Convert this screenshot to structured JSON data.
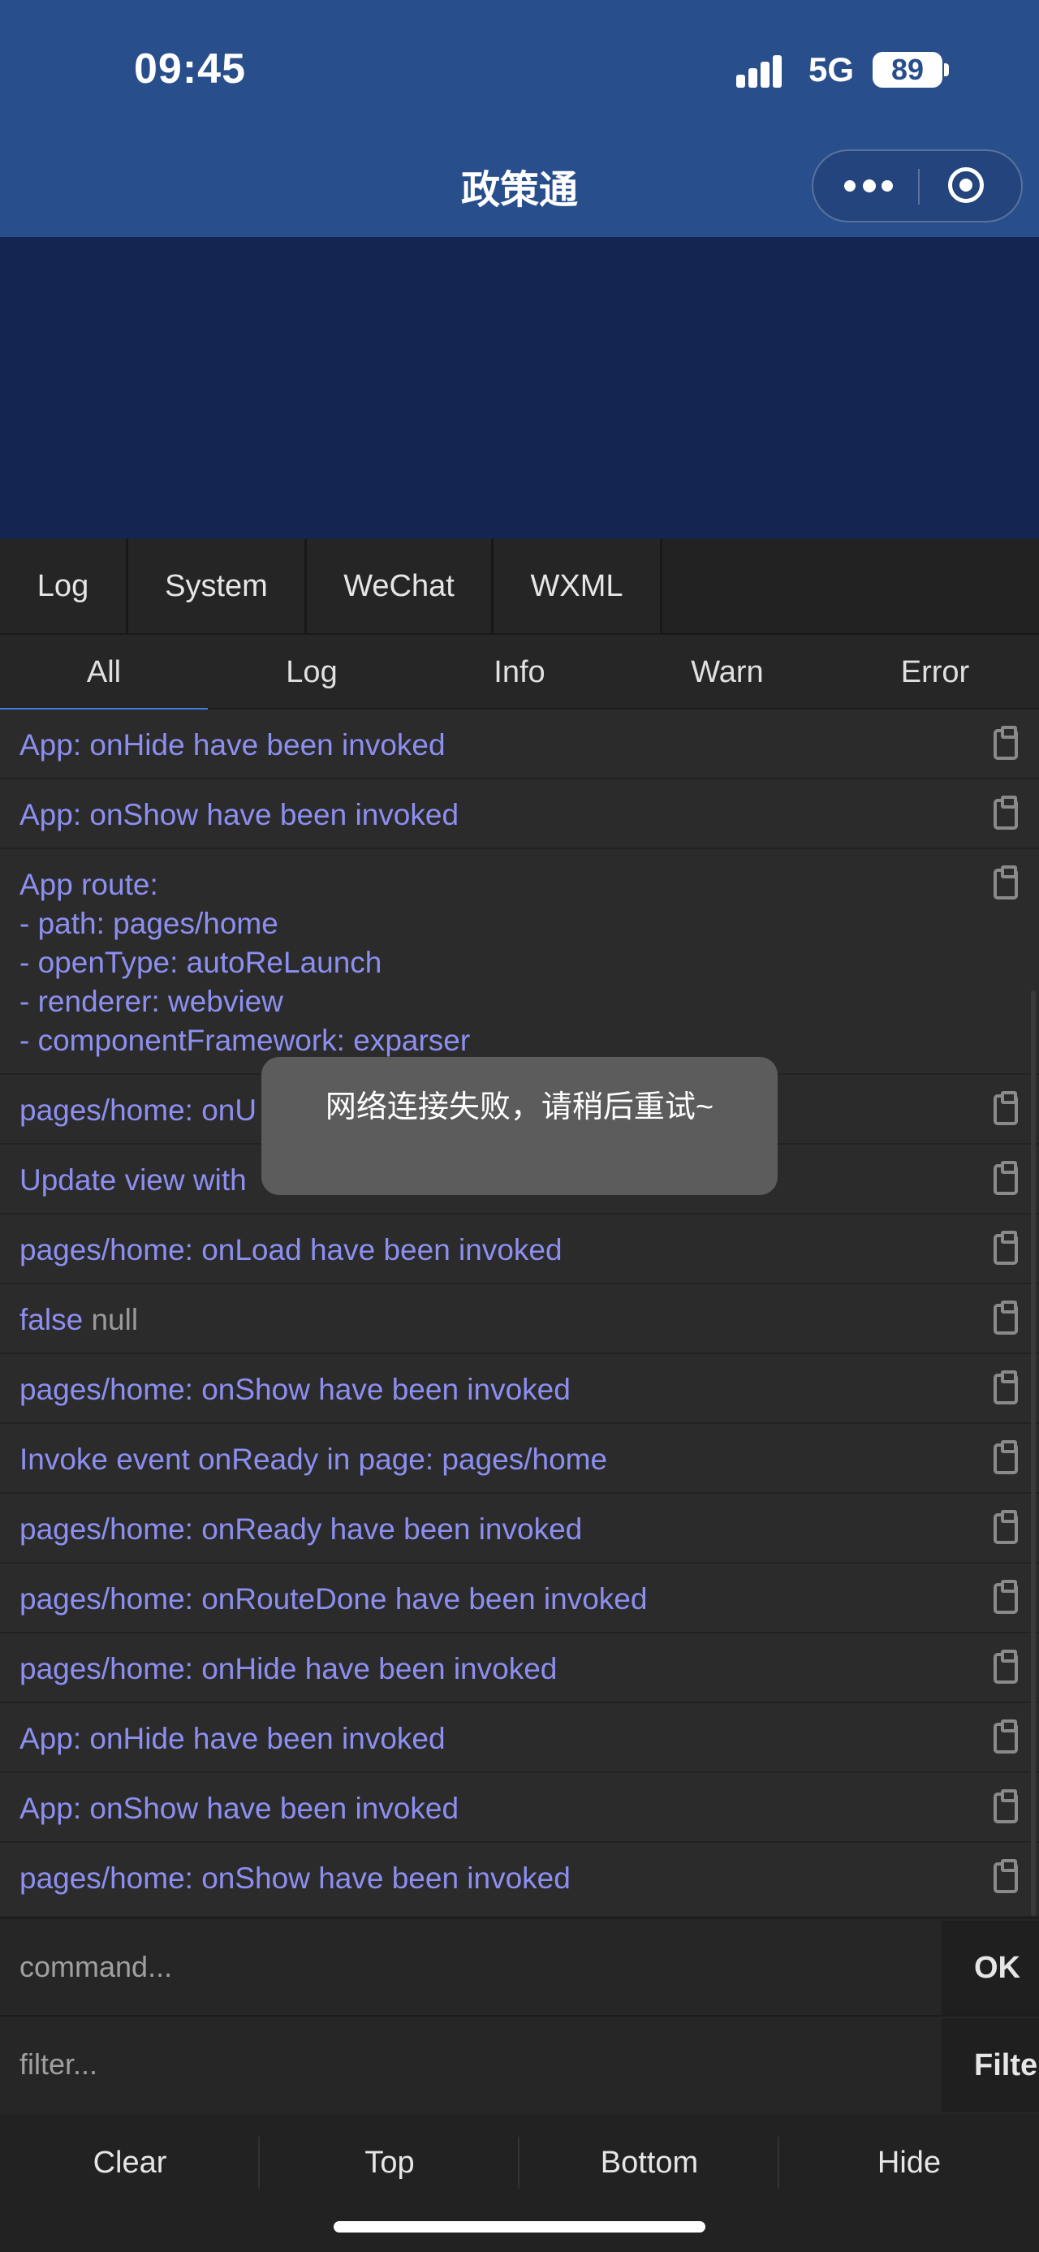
{
  "status_bar": {
    "time": "09:45",
    "network": "5G",
    "battery": "89"
  },
  "header": {
    "title": "政策通"
  },
  "tabs": [
    {
      "label": "Log"
    },
    {
      "label": "System"
    },
    {
      "label": "WeChat"
    },
    {
      "label": "WXML"
    }
  ],
  "levels": [
    {
      "label": "All",
      "active": true
    },
    {
      "label": "Log"
    },
    {
      "label": "Info"
    },
    {
      "label": "Warn"
    },
    {
      "label": "Error"
    }
  ],
  "logs": [
    {
      "text": "App: onHide have been invoked"
    },
    {
      "text": "App: onShow have been invoked"
    },
    {
      "text": "App route:\n- path: pages/home\n- openType: autoReLaunch\n- renderer: webview\n- componentFramework: exparser"
    },
    {
      "text": "pages/home: onU"
    },
    {
      "text": "Update view with"
    },
    {
      "text": "pages/home: onLoad have been invoked"
    },
    {
      "text": "false",
      "extra": "null"
    },
    {
      "text": "pages/home: onShow have been invoked"
    },
    {
      "text": "Invoke event onReady in page: pages/home"
    },
    {
      "text": "pages/home: onReady have been invoked"
    },
    {
      "text": "pages/home: onRouteDone have been invoked"
    },
    {
      "text": "pages/home: onHide have been invoked"
    },
    {
      "text": "App: onHide have been invoked"
    },
    {
      "text": "App: onShow have been invoked"
    },
    {
      "text": "pages/home: onShow have been invoked"
    }
  ],
  "toast": {
    "text": "网络连接失败，请稍后重试~"
  },
  "command": {
    "placeholder": "command...",
    "button": "OK"
  },
  "filter": {
    "placeholder": "filter...",
    "button": "Filter"
  },
  "bottom_bar": {
    "clear": "Clear",
    "top": "Top",
    "bottom": "Bottom",
    "hide": "Hide"
  }
}
